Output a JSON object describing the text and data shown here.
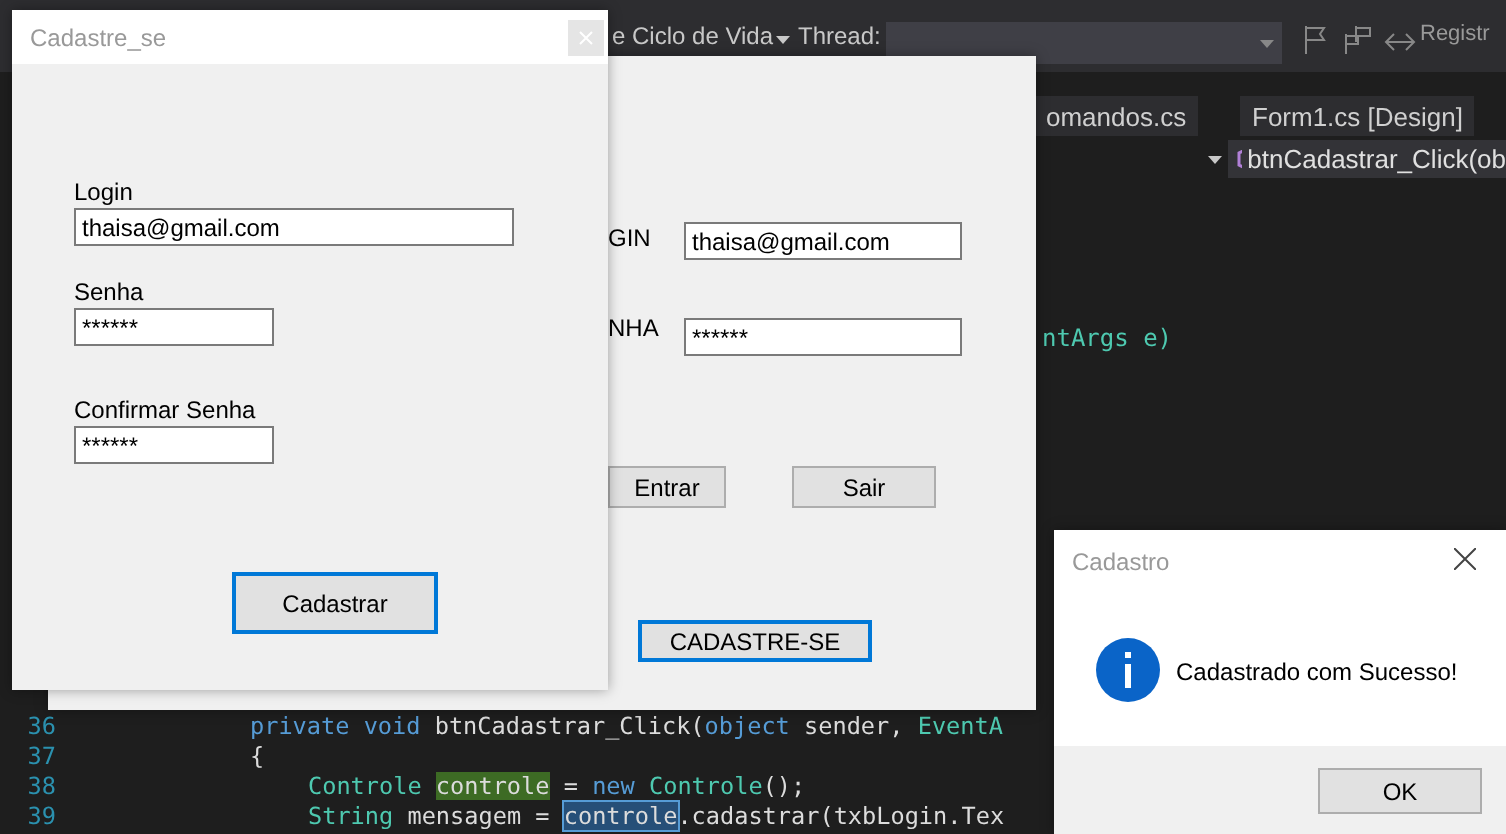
{
  "ide": {
    "toolbar": {
      "lifecycle": "e Ciclo de Vida",
      "thread_label": "Thread:",
      "register": "Registr"
    },
    "tabs": [
      {
        "label": "omandos.cs"
      },
      {
        "label": "Form1.cs [Design]"
      }
    ],
    "member_dropdown": "btnCadastrar_Click(ob",
    "side_code": "ntArgs e)",
    "code_lines": [
      {
        "number": "36",
        "kind": "decl",
        "tokens": [
          {
            "text": "private void ",
            "kind": "keyword"
          },
          {
            "text": "btnCadastrar_Click(",
            "kind": "plain"
          },
          {
            "text": "object",
            "kind": "keyword"
          },
          {
            "text": " sender, ",
            "kind": "plain"
          },
          {
            "text": "EventA",
            "kind": "type"
          }
        ]
      },
      {
        "number": "37",
        "kind": "decl",
        "tokens": [
          {
            "text": "{",
            "kind": "plain"
          }
        ]
      },
      {
        "number": "38",
        "kind": "body",
        "tokens": [
          {
            "text": "Controle ",
            "kind": "type"
          },
          {
            "text": "controle",
            "kind": "highlight"
          },
          {
            "text": " = ",
            "kind": "plain"
          },
          {
            "text": "new ",
            "kind": "keyword"
          },
          {
            "text": "Controle",
            "kind": "type"
          },
          {
            "text": "();",
            "kind": "plain"
          }
        ]
      },
      {
        "number": "39",
        "kind": "body",
        "tokens": [
          {
            "text": "String",
            "kind": "type"
          },
          {
            "text": " mensagem = ",
            "kind": "plain"
          },
          {
            "text": "controle",
            "kind": "selection"
          },
          {
            "text": ".cadastrar(txbLogin.Tex",
            "kind": "plain"
          }
        ]
      }
    ]
  },
  "login_form": {
    "login_label": "GIN",
    "login_value": "thaisa@gmail.com",
    "password_label": "NHA",
    "password_value": "******",
    "buttons": [
      {
        "label": "Entrar",
        "focused": false
      },
      {
        "label": "Sair",
        "focused": false
      },
      {
        "label": "CADASTRE-SE",
        "focused": true
      }
    ]
  },
  "register_form": {
    "title": "Cadastre_se",
    "fields": [
      {
        "label": "Login",
        "value": "thaisa@gmail.com",
        "kind": "wide"
      },
      {
        "label": "Senha",
        "value": "******",
        "kind": "short"
      },
      {
        "label": "Confirmar Senha",
        "value": "******",
        "kind": "short"
      }
    ],
    "button": {
      "label": "Cadastrar",
      "focused": true
    }
  },
  "message_box": {
    "title": "Cadastro",
    "message": "Cadastrado com Sucesso!",
    "button": "OK"
  }
}
